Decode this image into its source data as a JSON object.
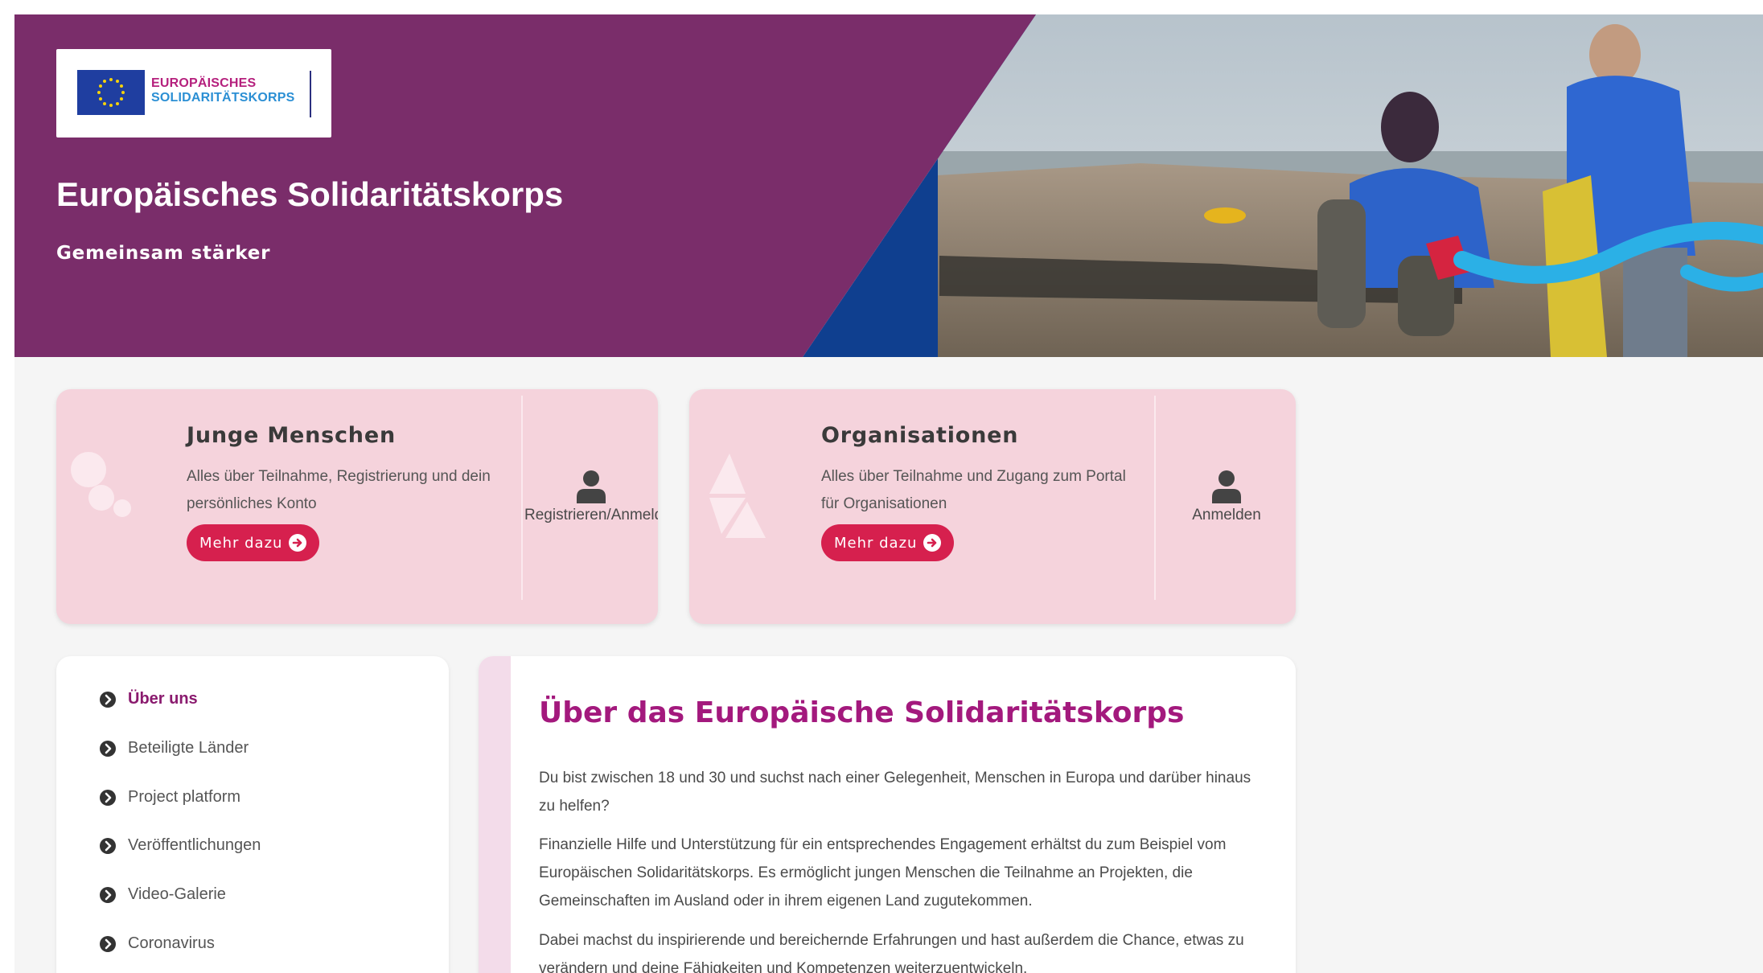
{
  "colors": {
    "hero_purple": "#7a2d6a",
    "hero_blue": "#0f3f8f",
    "card_pink": "#f5d3dc",
    "button_red": "#d6204e",
    "heading_magenta": "#a3197d"
  },
  "hero": {
    "logo": {
      "line1": "EUROPÄISCHES",
      "line2": "SOLIDARITÄTSKORPS"
    },
    "title": "Europäisches Solidaritätskorps",
    "subtitle": "Gemeinsam stärker"
  },
  "cards": {
    "young": {
      "title": "Junge Menschen",
      "description": "Alles über Teilnahme, Registrierung und dein persönliches Konto",
      "button_label": "Mehr dazu",
      "account_label": "Registrieren/Anmelden"
    },
    "organisations": {
      "title": "Organisationen",
      "description": "Alles über Teilnahme und Zugang zum Portal für Organisationen",
      "button_label": "Mehr dazu",
      "account_label": "Anmelden"
    }
  },
  "sidebar": {
    "items": [
      {
        "label": "Über uns",
        "active": true
      },
      {
        "label": "Beteiligte Länder",
        "active": false
      },
      {
        "label": "Project platform",
        "active": false
      },
      {
        "label": "Veröffentlichungen",
        "active": false
      },
      {
        "label": "Video-Galerie",
        "active": false
      },
      {
        "label": "Coronavirus",
        "active": false
      }
    ]
  },
  "main": {
    "title": "Über das Europäische Solidaritätskorps",
    "paragraphs": [
      "Du bist zwischen 18 und 30 und suchst nach einer Gelegenheit, Menschen in Europa und darüber hinaus zu helfen?",
      "Finanzielle Hilfe und Unterstützung für ein entsprechendes Engagement erhältst du zum Beispiel vom Europäischen Solidaritätskorps. Es ermöglicht jungen Menschen die Teilnahme an Projekten, die Gemeinschaften im Ausland oder in ihrem eigenen Land zugutekommen.",
      "Dabei machst du inspirierende und bereichernde Erfahrungen und hast außerdem die Chance, etwas zu verändern und deine Fähigkeiten und Kompetenzen weiterzuentwickeln."
    ]
  }
}
